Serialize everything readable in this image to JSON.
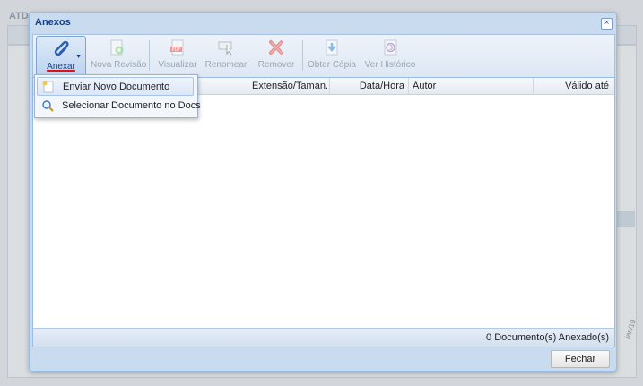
{
  "background": {
    "title": "ATDA",
    "timestamp": "jan/19"
  },
  "window": {
    "title": "Anexos",
    "close_label": "×"
  },
  "toolbar": {
    "anexar": "Anexar",
    "nova_revisao": "Nova Revisão",
    "visualizar": "Visualizar",
    "renomear": "Renomear",
    "remover": "Remover",
    "obter_copia": "Obter Cópia",
    "ver_historico": "Ver Histórico"
  },
  "grid": {
    "columns": [
      "",
      "Extensão/Taman...",
      "Data/Hora",
      "Autor",
      "Válido até"
    ],
    "footer": "0 Documento(s) Anexado(s)"
  },
  "menu": {
    "items": [
      "Enviar Novo Documento",
      "Selecionar Documento no Docs"
    ]
  },
  "buttons": {
    "fechar": "Fechar"
  },
  "icons": {
    "anexar": "paperclip-icon",
    "nova_revisao": "revision-icon",
    "visualizar": "pdf-icon",
    "renomear": "rename-icon",
    "remover": "remove-icon",
    "obter_copia": "download-copy-icon",
    "ver_historico": "history-icon",
    "enviar": "new-document-icon",
    "selecionar": "search-icon"
  },
  "colors": {
    "accent": "#15428b",
    "window_border": "#99bbe8",
    "remove": "#d9534f"
  }
}
